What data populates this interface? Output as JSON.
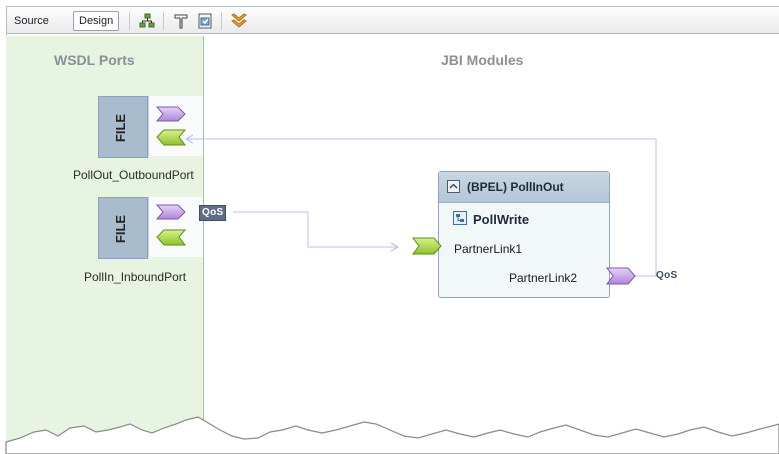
{
  "toolbar": {
    "source_tab": "Source",
    "design_tab": "Design",
    "buttons": [
      "auto-layout-icon",
      "build-icon",
      "deploy-icon",
      "expand-all-icon"
    ]
  },
  "columns": {
    "wsdl_title": "WSDL Ports",
    "jbi_title": "JBI Modules"
  },
  "ports": [
    {
      "type_label": "FILE",
      "name": "PollOut_OutboundPort",
      "qos": ""
    },
    {
      "type_label": "FILE",
      "name": "PollIn_InboundPort",
      "qos": "QoS"
    }
  ],
  "module": {
    "title": "(BPEL) PollInOut",
    "process": "PollWrite",
    "partner_link_1": "PartnerLink1",
    "partner_link_2": "PartnerLink2",
    "qos": "QoS"
  },
  "colors": {
    "wsdl_bg": "#e6f4e1",
    "consumer_chevron": "#c9a8e8",
    "provider_chevron": "#a8d84a",
    "connection_line": "#b8c0f0",
    "qos_badge": "#5d6e86"
  }
}
